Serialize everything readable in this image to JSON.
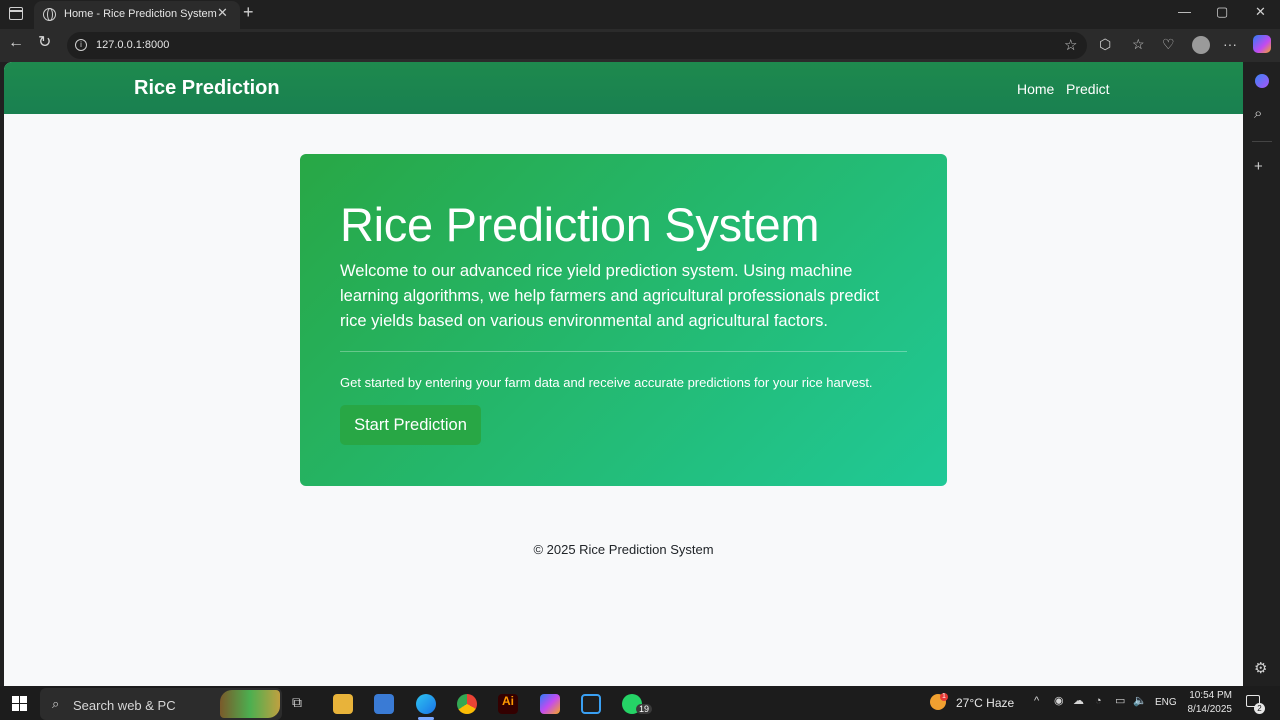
{
  "browser": {
    "tab_title": "Home - Rice Prediction System",
    "url": "127.0.0.1:8000"
  },
  "page": {
    "brand": "Rice Prediction",
    "nav": [
      {
        "label": "Home"
      },
      {
        "label": "Predict"
      }
    ],
    "hero": {
      "title": "Rice Prediction System",
      "lead": "Welcome to our advanced rice yield prediction system. Using machine learning algorithms, we help farmers and agricultural professionals predict rice yields based on various environmental and agricultural factors.",
      "text": "Get started by entering your farm data and receive accurate predictions for your rice harvest.",
      "button": "Start Prediction"
    },
    "footer": "© 2025 Rice Prediction System"
  },
  "taskbar": {
    "search_placeholder": "Search web & PC",
    "whatsapp_badge": "19",
    "weather_badge": "1",
    "weather": "27°C  Haze",
    "language": "ENG",
    "time": "10:54 PM",
    "date": "8/14/2025",
    "notification_count": "2",
    "ai_label": "Ai"
  },
  "colors": {
    "navbar": "#198754",
    "hero_start": "#28a745",
    "hero_end": "#20c997"
  }
}
